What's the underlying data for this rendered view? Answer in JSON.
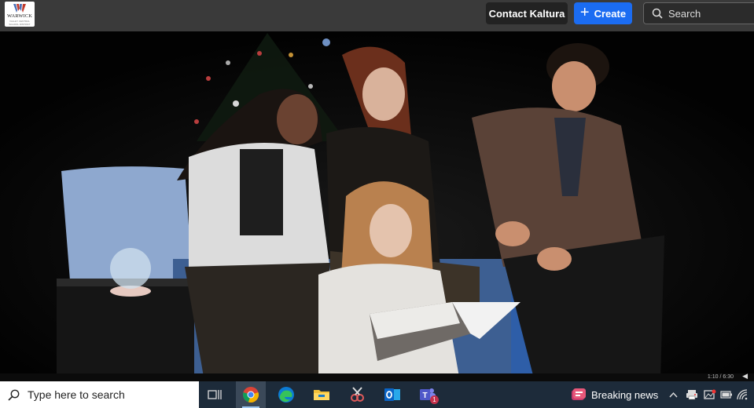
{
  "header": {
    "logo_text": "WARWICK",
    "logo_subtext": "VALLEY CENTRAL SCHOOL DISTRICT",
    "contact_label": "Contact Kaltura",
    "create_label": "Create",
    "search_placeholder": "Search"
  },
  "video": {
    "timecode": "1:10 / 6:30"
  },
  "taskbar": {
    "search_placeholder": "Type here to search",
    "apps": [
      "task-view",
      "chrome",
      "edge",
      "file-explorer",
      "snipping-tool",
      "outlook",
      "teams"
    ],
    "teams_badge": "1",
    "news_label": "Breaking news"
  },
  "colors": {
    "accent": "#1b6cf2",
    "topbar": "#3a3a3a",
    "taskbar": "#1d2b3a"
  }
}
